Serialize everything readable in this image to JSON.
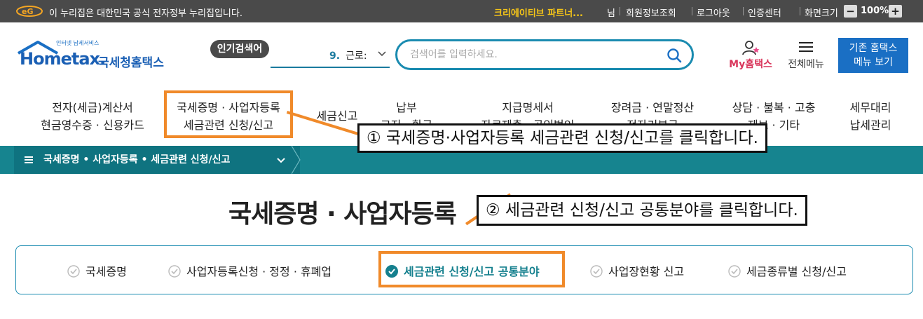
{
  "gov_bar": {
    "text": "이 누리집은 대한민국 공식 전자정부 누리집입니다.",
    "user_name": "크리에이티브 파트너...",
    "user_suffix": "님",
    "links": [
      "회원정보조회",
      "로그아웃",
      "인증센터",
      "화면크기"
    ],
    "zoom": "100%",
    "zoom_out": "−",
    "zoom_in": "+"
  },
  "header": {
    "logo_small": "인터넷 납세서비스",
    "logo_text": "Hometax.",
    "logo_korean": "국세청홈택스",
    "popular_label": "인기검색어",
    "popular_rank": "9.",
    "popular_term": "근로:",
    "search_placeholder": "검색어를 입력하세요.",
    "my_hometax": "My홈택스",
    "all_menu": "전체메뉴",
    "old_menu_line1": "기존 홈택스",
    "old_menu_line2": "메뉴 보기"
  },
  "nav": [
    {
      "line1": "전자(세금)계산서",
      "line2": "현금영수증 · 신용카드"
    },
    {
      "line1": "국세증명 · 사업자등록",
      "line2": "세금관련 신청/신고"
    },
    {
      "line1": "세금신고",
      "line2": ""
    },
    {
      "line1": "납부",
      "line2": "고지 · 환급"
    },
    {
      "line1": "지급명세서",
      "line2": "자료제출 · 공익법인"
    },
    {
      "line1": "장려금 · 연말정산",
      "line2": "전자기부금"
    },
    {
      "line1": "상담 · 불복 · 고충",
      "line2": "제보 · 기타"
    },
    {
      "line1": "세무대리",
      "line2": "납세관리"
    }
  ],
  "breadcrumb": "국세증명 • 사업자등록 • 세금관련 신청/신고",
  "page_title": "국세증명 · 사업자등록",
  "sub_tabs": [
    "국세증명",
    "사업자등록신청 · 정정 · 휴폐업",
    "세금관련 신청/신고 공통분야",
    "사업장현황 신고",
    "세금종류별 신청/신고"
  ],
  "active_sub_tab": 2,
  "callouts": [
    "① 국세증명·사업자등록 세금관련 신청/신고를 클릭합니다.",
    "② 세금관련 신청/신고 공통분야를 클릭합니다."
  ],
  "colors": {
    "gov_bar": "#4a4a4a",
    "accent_teal": "#16848f",
    "search_border": "#1a8bb0",
    "highlight_orange": "#f08a2a",
    "old_menu_btn": "#1a6fc4"
  }
}
